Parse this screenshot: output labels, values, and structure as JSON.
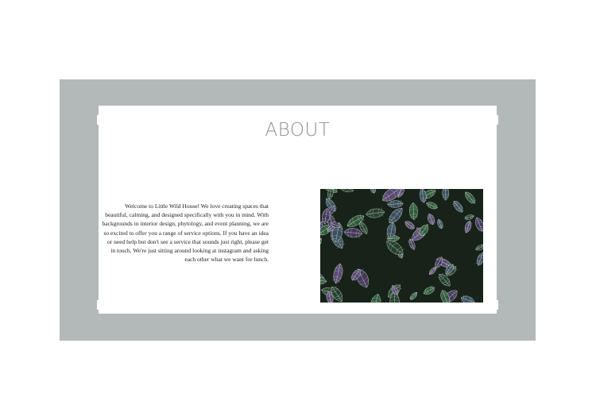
{
  "about": {
    "heading": "ABOUT",
    "paragraph": "Welcome to Little Wild House! We love creating spaces that beautiful, calming, and designed specifically with you in mind. With backgrounds in interior design, phytology, and event planning, we are so excited to offer you a range of service options. If you have an idea or need help but don't see a service that sounds just right, please get in touch. We're just sitting around looking at instagram and asking each other what we want for lunch.",
    "image_icon": "leaf-plant-photo"
  },
  "colors": {
    "band": "#b3b8b9",
    "card": "#ffffff",
    "heading": "#8e8e8e",
    "body_text": "#222222",
    "leaf_dark": "#172319",
    "leaf_green": "#2f5a3a",
    "leaf_purple": "#5a4a72",
    "vein": "#cfd9d6"
  }
}
